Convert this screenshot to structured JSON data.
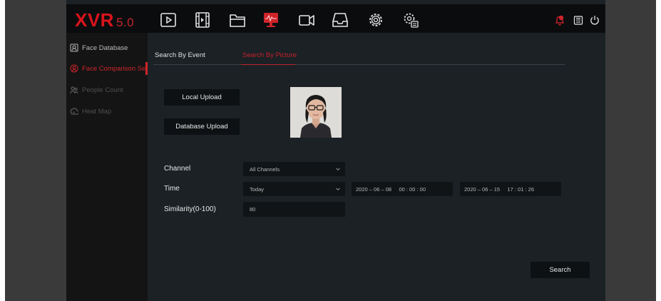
{
  "app": {
    "logo": "XVR",
    "version": "5.0"
  },
  "topbar": {
    "icons": [
      "playback-icon",
      "video-file-icon",
      "folder-icon",
      "ai-monitor-icon",
      "camera-icon",
      "storage-icon",
      "settings-gear-icon",
      "system-settings-icon"
    ],
    "active_icon": "ai-monitor-icon",
    "right_icons": [
      "alarm-bell-icon",
      "backup-icon",
      "power-icon"
    ],
    "alarm_badge": "0"
  },
  "sidebar": {
    "items": [
      {
        "label": "Face Database",
        "icon": "face-database-icon",
        "state": "normal"
      },
      {
        "label": "Face Comparison Search",
        "icon": "face-search-icon",
        "state": "active"
      },
      {
        "label": "People Count",
        "icon": "people-count-icon",
        "state": "disabled"
      },
      {
        "label": "Heat Map",
        "icon": "heat-map-icon",
        "state": "disabled"
      }
    ]
  },
  "tabs": {
    "search_by_event": "Search By Event",
    "search_by_picture": "Search By Picture",
    "active": "Search By Picture"
  },
  "upload": {
    "local": "Local Upload",
    "database": "Database Upload"
  },
  "form": {
    "channel_label": "Channel",
    "channel_value": "All Channels",
    "time_label": "Time",
    "time_value": "Today",
    "start_datetime": "2020 – 06 – 08     00 : 00 : 00",
    "end_datetime": "2020 – 06 – 15     17 : 01 : 26",
    "similarity_label": "Similarity(0-100)",
    "similarity_value": "80"
  },
  "actions": {
    "search": "Search"
  },
  "colors": {
    "accent": "#c3222a",
    "logo": "#d8141c",
    "background": "#1b2125",
    "topbar": "#0b0c0e",
    "sidebar": "#141414"
  }
}
